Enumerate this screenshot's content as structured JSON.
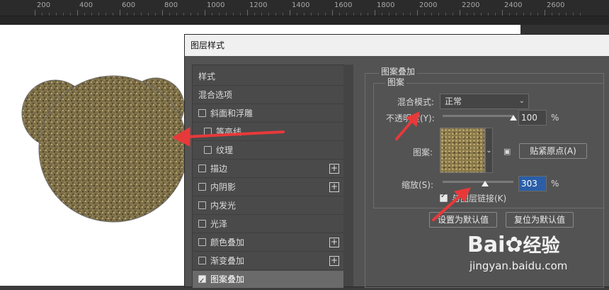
{
  "ruler": {
    "ticks": [
      "200",
      "400",
      "600",
      "800",
      "1000",
      "1200",
      "1400",
      "1600",
      "1800",
      "2000",
      "2200",
      "2400",
      "2600"
    ]
  },
  "dialog": {
    "title": "图层样式",
    "left_list": [
      {
        "label": "样式",
        "checkbox": false,
        "checked": false,
        "plus": false,
        "indent": false,
        "selected": false
      },
      {
        "label": "混合选项",
        "checkbox": false,
        "checked": false,
        "plus": false,
        "indent": false,
        "selected": false
      },
      {
        "label": "斜面和浮雕",
        "checkbox": true,
        "checked": false,
        "plus": false,
        "indent": false,
        "selected": false
      },
      {
        "label": "等高线",
        "checkbox": true,
        "checked": false,
        "plus": false,
        "indent": true,
        "selected": false
      },
      {
        "label": "纹理",
        "checkbox": true,
        "checked": false,
        "plus": false,
        "indent": true,
        "selected": false
      },
      {
        "label": "描边",
        "checkbox": true,
        "checked": false,
        "plus": true,
        "indent": false,
        "selected": false
      },
      {
        "label": "内阴影",
        "checkbox": true,
        "checked": false,
        "plus": true,
        "indent": false,
        "selected": false
      },
      {
        "label": "内发光",
        "checkbox": true,
        "checked": false,
        "plus": false,
        "indent": false,
        "selected": false
      },
      {
        "label": "光泽",
        "checkbox": true,
        "checked": false,
        "plus": false,
        "indent": false,
        "selected": false
      },
      {
        "label": "颜色叠加",
        "checkbox": true,
        "checked": false,
        "plus": true,
        "indent": false,
        "selected": false
      },
      {
        "label": "渐变叠加",
        "checkbox": true,
        "checked": false,
        "plus": true,
        "indent": false,
        "selected": false
      },
      {
        "label": "图案叠加",
        "checkbox": true,
        "checked": true,
        "plus": false,
        "indent": false,
        "selected": true
      }
    ],
    "pattern_overlay": {
      "section_title": "图案叠加",
      "group_title": "图案",
      "blend_mode_label": "混合模式:",
      "blend_mode_value": "正常",
      "opacity_label": "不透明度(Y):",
      "opacity_value": "100",
      "opacity_fraction": 1.0,
      "pattern_label": "图案:",
      "snap_button": "贴紧原点(A)",
      "scale_label": "缩放(S):",
      "scale_value": "303",
      "scale_fraction": 0.6,
      "percent": "%",
      "link_label": "与图层链接(K)",
      "link_checked": true,
      "set_default_button": "设置为默认值",
      "reset_default_button": "复位为默认值"
    }
  },
  "watermark": {
    "brand": "Bai",
    "brand2": "经验",
    "url": "jingyan.baidu.com"
  },
  "colors": {
    "arrow": "#e8393a",
    "highlight": "#2a5ea8"
  }
}
